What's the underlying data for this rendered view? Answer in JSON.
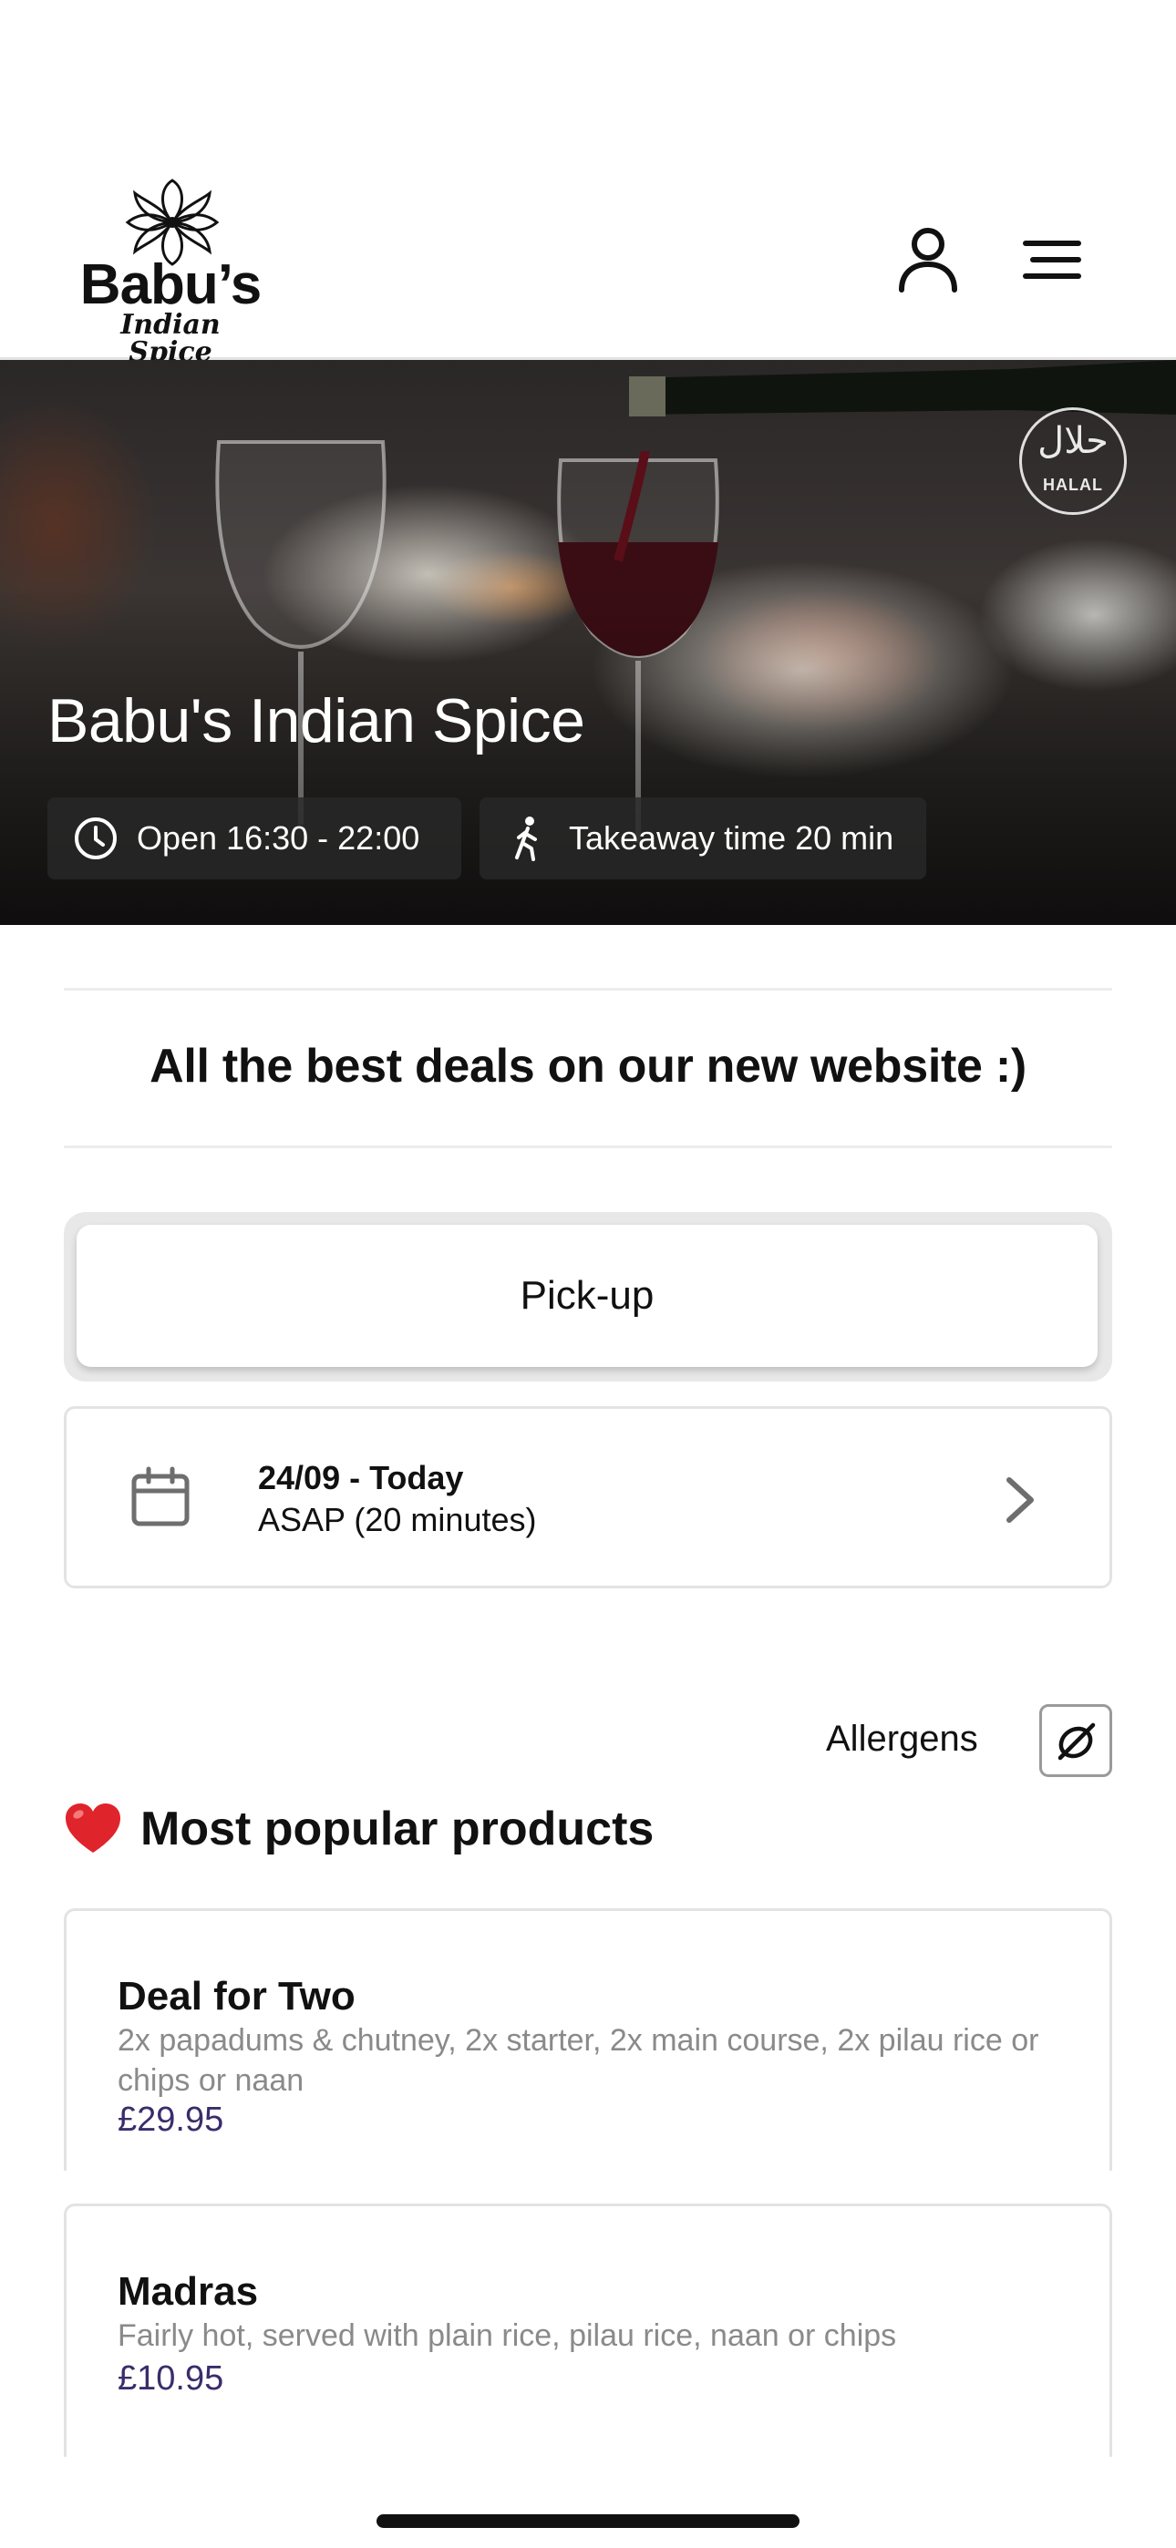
{
  "header": {
    "logo": {
      "title": "Babu’s",
      "subtitle": "Indian Spice"
    },
    "account_icon": "person-icon",
    "menu_icon": "hamburger-menu-icon"
  },
  "hero": {
    "title": "Babu's Indian Spice",
    "halal_badge": {
      "script": "حلال",
      "label": "HALAL"
    },
    "open_hours": "Open 16:30 - 22:00",
    "takeaway": "Takeaway time 20 min"
  },
  "announcement": "All the best deals on our new website :)",
  "pickup": {
    "label": "Pick-up"
  },
  "schedule": {
    "date": "24/09 - Today",
    "time": "ASAP (20 minutes)"
  },
  "allergens": {
    "label": "Allergens"
  },
  "popular": {
    "title": "Most popular products",
    "products": [
      {
        "name": "Deal for Two",
        "description": "2x papadums & chutney, 2x starter, 2x main course, 2x pilau rice or chips or naan",
        "price": "£29.95"
      },
      {
        "name": "Madras",
        "description": "Fairly hot, served with plain rice, pilau rice, naan or chips",
        "price": "£10.95"
      }
    ]
  },
  "colors": {
    "price": "#3b2d6b",
    "heart": "#e0242b",
    "divider": "#e3e3e3"
  }
}
